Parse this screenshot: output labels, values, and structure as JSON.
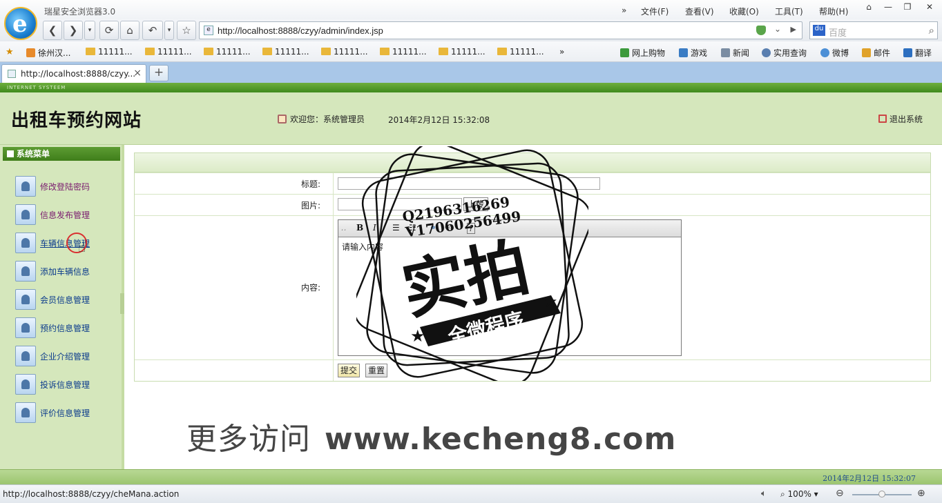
{
  "browser": {
    "app_title": "瑞星安全浏览器3.0",
    "menu": [
      "文件(F)",
      "查看(V)",
      "收藏(O)",
      "工具(T)",
      "帮助(H)"
    ],
    "address": "http://localhost:8888/czyy/admin/index.jsp",
    "search_placeholder": "百度",
    "favorites": [
      "徐州汉...",
      "11111...",
      "11111...",
      "11111...",
      "11111...",
      "11111...",
      "11111...",
      "11111...",
      "11111..."
    ],
    "tools": [
      "网上购物",
      "游戏",
      "新闻",
      "实用查询",
      "微博",
      "邮件",
      "翻译"
    ],
    "tab_title": "http://localhost:8888/czyy...",
    "status_url": "http://localhost:8888/czyy/cheMana.action",
    "zoom": "100%"
  },
  "site": {
    "strip_text": "INTERNET SYSTEEM",
    "title": "出租车预约网站",
    "welcome": "欢迎您：系统管理员",
    "datetime": "2014年2月12日  15:32:08",
    "logout": "退出系统",
    "footer_time": "2014年2月12日  15:32:07"
  },
  "sidebar": {
    "title": "系统菜单",
    "items": [
      {
        "label": "修改登陆密码"
      },
      {
        "label": "信息发布管理"
      },
      {
        "label": "车辆信息管理"
      },
      {
        "label": "添加车辆信息"
      },
      {
        "label": "会员信息管理"
      },
      {
        "label": "预约信息管理"
      },
      {
        "label": "企业介绍管理"
      },
      {
        "label": "投诉信息管理"
      },
      {
        "label": "评价信息管理"
      }
    ]
  },
  "form": {
    "title_label": "标题:",
    "image_label": "图片:",
    "upload_button": "上传",
    "content_label": "内容:",
    "editor_placeholder": "请输入内容",
    "submit": "提交",
    "reset": "重置"
  },
  "overlay": {
    "stamp_contact_1": "Q2196316269",
    "stamp_contact_2": "V17060256499",
    "stamp_main": "实拍",
    "stamp_sub": "全微程序",
    "watermark_cn": "更多访问",
    "watermark_url": "www.kecheng8.com"
  }
}
